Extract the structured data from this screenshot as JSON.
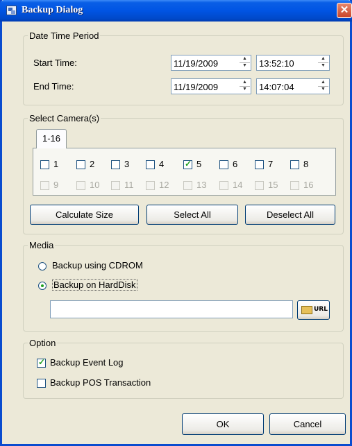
{
  "window": {
    "title": "Backup Dialog",
    "close_symbol": "✕"
  },
  "date_time_period": {
    "legend": "Date Time Period",
    "start_label": "Start Time:",
    "start_date": "11/19/2009",
    "start_time": "13:52:10",
    "end_label": "End Time:",
    "end_date": "11/19/2009",
    "end_time": "14:07:04"
  },
  "select_cameras": {
    "legend": "Select Camera(s)",
    "tab_label": "1-16",
    "cameras": [
      {
        "label": "1",
        "checked": false,
        "enabled": true
      },
      {
        "label": "2",
        "checked": false,
        "enabled": true
      },
      {
        "label": "3",
        "checked": false,
        "enabled": true
      },
      {
        "label": "4",
        "checked": false,
        "enabled": true
      },
      {
        "label": "5",
        "checked": true,
        "enabled": true
      },
      {
        "label": "6",
        "checked": false,
        "enabled": true
      },
      {
        "label": "7",
        "checked": false,
        "enabled": true
      },
      {
        "label": "8",
        "checked": false,
        "enabled": true
      },
      {
        "label": "9",
        "checked": false,
        "enabled": false
      },
      {
        "label": "10",
        "checked": false,
        "enabled": false
      },
      {
        "label": "11",
        "checked": false,
        "enabled": false
      },
      {
        "label": "12",
        "checked": false,
        "enabled": false
      },
      {
        "label": "13",
        "checked": false,
        "enabled": false
      },
      {
        "label": "14",
        "checked": false,
        "enabled": false
      },
      {
        "label": "15",
        "checked": false,
        "enabled": false
      },
      {
        "label": "16",
        "checked": false,
        "enabled": false
      }
    ],
    "calculate_size": "Calculate Size",
    "select_all": "Select All",
    "deselect_all": "Deselect All"
  },
  "media": {
    "legend": "Media",
    "option_cdrom": "Backup using CDROM",
    "option_harddisk": "Backup on HardDisk",
    "selected": "harddisk",
    "path_value": "",
    "url_button_label": "URL"
  },
  "option": {
    "legend": "Option",
    "event_log_label": "Backup Event Log",
    "event_log_checked": true,
    "pos_label": "Backup POS Transaction",
    "pos_checked": false
  },
  "buttons": {
    "ok": "OK",
    "cancel": "Cancel"
  },
  "colors": {
    "title_bar": "#0054e3",
    "dialog_bg": "#ece9d8",
    "check_mark": "#21a121",
    "close_button": "#c9442a"
  }
}
